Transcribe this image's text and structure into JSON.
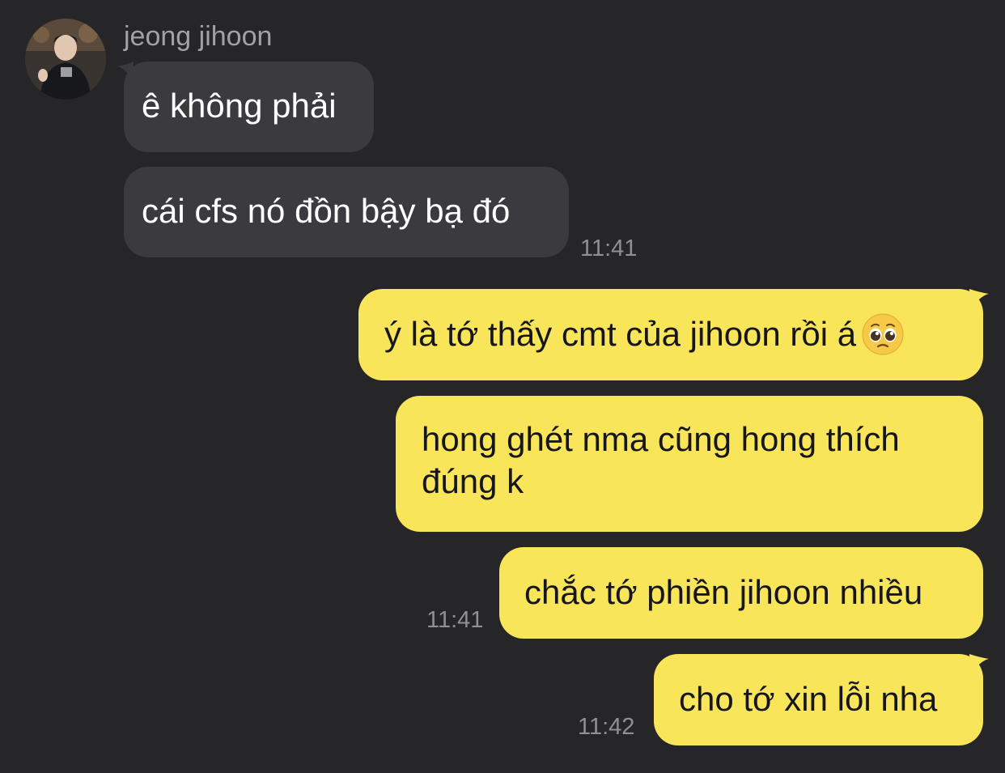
{
  "chat": {
    "sender_name": "jeong jihoon",
    "avatar_icon": "profile-photo-avatar",
    "colors": {
      "background": "#262629",
      "incoming_bubble": "#3b3b3f",
      "outgoing_bubble": "#f9e55a"
    },
    "messages": [
      {
        "direction": "incoming",
        "text": "ê không phải"
      },
      {
        "direction": "incoming",
        "text": "cái cfs nó đồn bậy bạ đó",
        "time": "11:41"
      },
      {
        "direction": "outgoing",
        "text": "ý là tớ thấy cmt của jihoon rồi á",
        "emoji": "pleading-face-emoji"
      },
      {
        "direction": "outgoing",
        "line1": "hong ghét nma cũng hong thích",
        "line2": "đúng k"
      },
      {
        "direction": "outgoing",
        "text": "chắc tớ phiền jihoon nhiều",
        "time": "11:41"
      },
      {
        "direction": "outgoing",
        "text": "cho tớ xin lỗi nha",
        "time": "11:42"
      }
    ]
  }
}
